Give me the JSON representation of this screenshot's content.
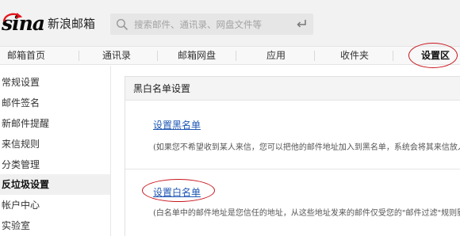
{
  "header": {
    "logo_text": "sina",
    "logo_suffix": "新浪邮箱",
    "search": {
      "placeholder": "搜索邮件、通讯录、网盘文件等"
    }
  },
  "nav": {
    "items": [
      {
        "label": "邮箱首页"
      },
      {
        "label": "通讯录"
      },
      {
        "label": "邮箱网盘"
      },
      {
        "label": "应用"
      },
      {
        "label": "收件夹"
      },
      {
        "label": "设置区"
      }
    ],
    "active": "设置区"
  },
  "sidebar": {
    "items": [
      {
        "label": "常规设置"
      },
      {
        "label": "邮件签名"
      },
      {
        "label": "新邮件提醒"
      },
      {
        "label": "来信规则"
      },
      {
        "label": "分类管理"
      },
      {
        "label": "反垃圾设置"
      },
      {
        "label": "帐户中心"
      },
      {
        "label": "实验室"
      }
    ],
    "active": "反垃圾设置"
  },
  "main": {
    "section_title": "黑白名单设置",
    "blacklist": {
      "link": "设置黑名单",
      "desc": "(如果您不希望收到某人来信，您可以把他的邮件地址加入到黑名单，系统会将其来信放入垃"
    },
    "whitelist": {
      "link": "设置白名单",
      "desc": "(白名单中的邮件地址是您信任的地址，从这些地址发来的邮件仅受您的\"邮件过滤\"规则影响"
    }
  },
  "colors": {
    "link": "#1f57b4",
    "highlight_oval": "#c8161d"
  }
}
